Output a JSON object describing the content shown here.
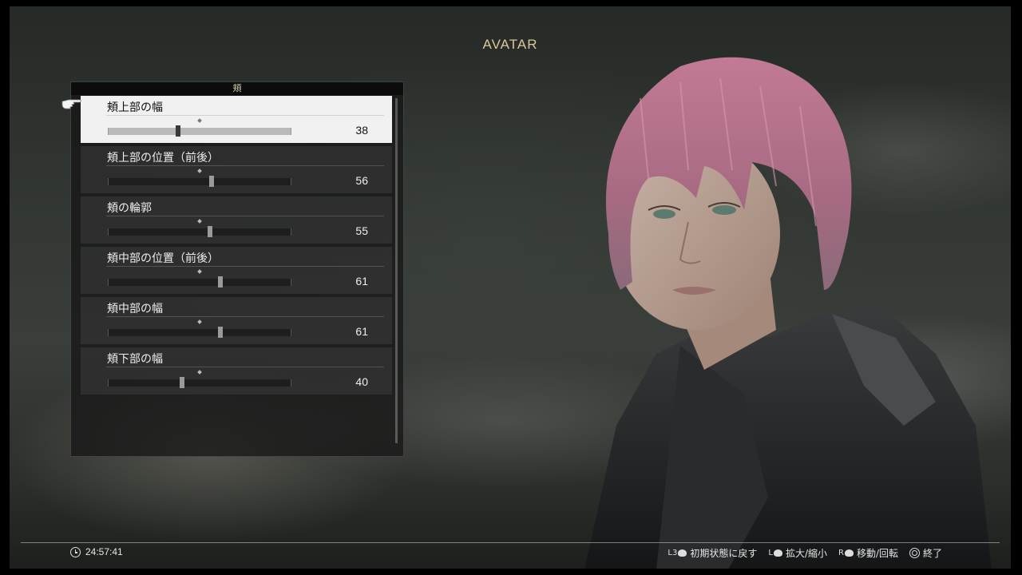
{
  "header": {
    "title": "AVATAR"
  },
  "panel": {
    "title": "頬",
    "selected_index": 0,
    "items": [
      {
        "label": "頬上部の幅",
        "value": "38",
        "level": 38
      },
      {
        "label": "頬上部の位置（前後）",
        "value": "56",
        "level": 56
      },
      {
        "label": "頬の輪郭",
        "value": "55",
        "level": 55
      },
      {
        "label": "頬中部の位置（前後）",
        "value": "61",
        "level": 61
      },
      {
        "label": "頬中部の幅",
        "value": "61",
        "level": 61
      },
      {
        "label": "頬下部の幅",
        "value": "40",
        "level": 40
      }
    ]
  },
  "footer": {
    "time": "24:57:41",
    "controls": [
      {
        "button": "L3",
        "label": "初期状態に戻す",
        "icon": "l3-stick-icon"
      },
      {
        "button": "L",
        "label": "拡大/縮小",
        "icon": "left-stick-icon"
      },
      {
        "button": "R",
        "label": "移動/回転",
        "icon": "right-stick-icon"
      },
      {
        "button": "",
        "label": "終了",
        "icon": "circle-button-icon"
      }
    ]
  },
  "colors": {
    "title": "#d9c79a",
    "selected_row": "#f1f1f1",
    "hair": "#b9728e"
  }
}
